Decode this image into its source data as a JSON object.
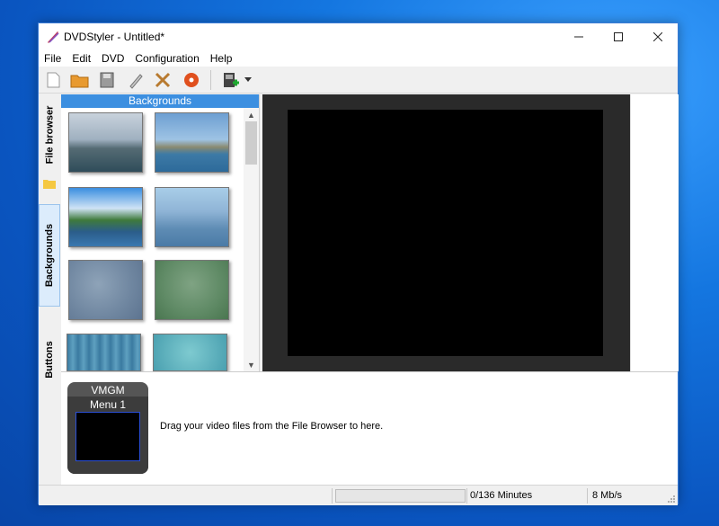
{
  "window": {
    "title": "DVDStyler - Untitled*"
  },
  "menu": [
    "File",
    "Edit",
    "DVD",
    "Configuration",
    "Help"
  ],
  "icons": {
    "app": "dvdstyler-app-icon",
    "toolbar": [
      "new-file-icon",
      "open-folder-icon",
      "save-disk-icon",
      "burn-pen-icon",
      "settings-tools-icon",
      "burn-disc-icon",
      "add-video-icon",
      "dropdown-arrow-icon"
    ]
  },
  "sidebar": {
    "tabs": [
      "File browser",
      "Backgrounds",
      "Buttons"
    ],
    "active_tab": "Backgrounds"
  },
  "backgrounds_panel": {
    "header": "Backgrounds",
    "thumbnails": [
      "sea-landscape",
      "coast-landscape",
      "lake-landscape",
      "misty-mountains",
      "blue-gray-blur",
      "green-blur",
      "blue-stripes",
      "turquoise-texture"
    ]
  },
  "titleset": {
    "vmgm_label": "VMGM",
    "menu_label": "Menu 1",
    "drag_hint": "Drag your video files from the File Browser to here."
  },
  "status": {
    "progress": 0,
    "minutes": "0/136 Minutes",
    "bitrate": "8 Mb/s"
  },
  "colors": {
    "accent": "#3c8fe0",
    "desktop": "#0a62d0",
    "canvas": "#000000"
  }
}
